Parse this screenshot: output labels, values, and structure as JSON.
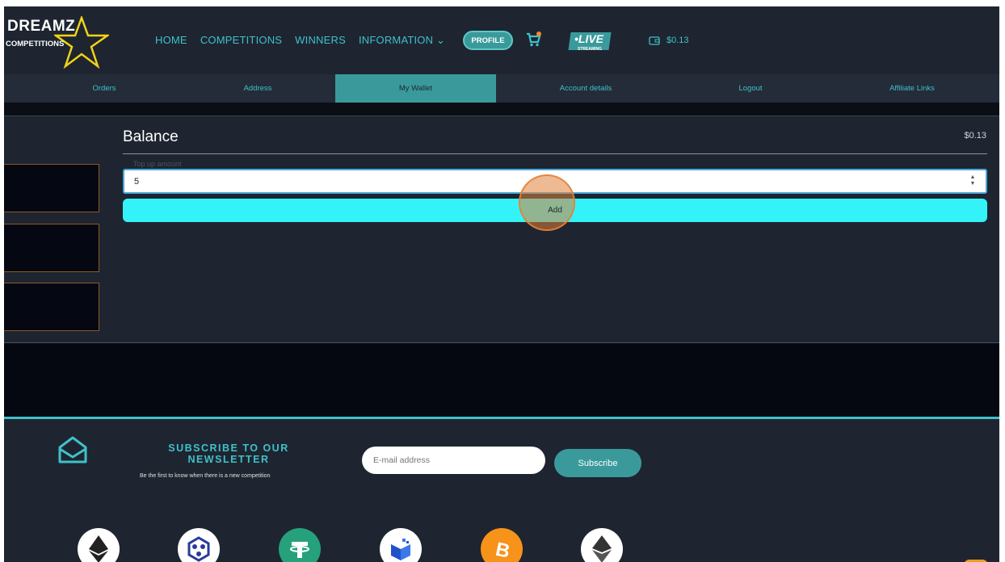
{
  "header": {
    "logo": {
      "line1": "DREAMZ",
      "line2": "COMPETITIONS"
    },
    "nav": [
      {
        "label": "HOME"
      },
      {
        "label": "COMPETITIONS"
      },
      {
        "label": "WINNERS"
      },
      {
        "label": "INFORMATION ⌄"
      }
    ],
    "profile_label": "PROFILE",
    "live": {
      "title": "•LIVE",
      "subtitle": "STREAMING"
    },
    "wallet_amount": "$0.13"
  },
  "tabs": [
    {
      "label": "Orders",
      "active": false
    },
    {
      "label": "Address",
      "active": false
    },
    {
      "label": "My Wallet",
      "active": true
    },
    {
      "label": "Account details",
      "active": false
    },
    {
      "label": "Logout",
      "active": false
    },
    {
      "label": "Affiliate Links",
      "active": false
    }
  ],
  "balance": {
    "title": "Balance",
    "value": "$0.13",
    "amount_label": "Top up amount",
    "amount_value": "5",
    "add_label": "Add"
  },
  "newsletter": {
    "title": "SUBSCRIBE TO OUR NEWSLETTER",
    "text": "Be the first to know when there is a new competition",
    "email_placeholder": "E-mail address",
    "subscribe_label": "Subscribe"
  },
  "coins": [
    {
      "icon": "ethereum-icon",
      "color": "#ffffff"
    },
    {
      "icon": "network-coin-icon",
      "color": "#ffffff"
    },
    {
      "icon": "tether-icon",
      "color": "#26a17b"
    },
    {
      "icon": "blue-coin-icon",
      "color": "#ffffff"
    },
    {
      "icon": "bitcoin-icon",
      "color": "#f7931a"
    },
    {
      "icon": "ethereum-classic-icon",
      "color": "#ffffff"
    }
  ],
  "colors": {
    "accent": "#3fc1c9",
    "button": "#33f3f8",
    "background": "#1e2530"
  }
}
